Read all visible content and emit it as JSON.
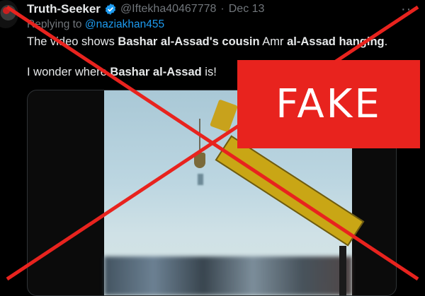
{
  "tweet": {
    "display_name": "Truth-Seeker",
    "handle": "@Iftekha40467778",
    "separator": "·",
    "time": "Dec 13",
    "more": "···",
    "replying_prefix": "Replying to ",
    "replying_to": "@naziakhan455",
    "line1": {
      "t1": "The video shows ",
      "b1": "Bashar al-Assad's cousin",
      "t2": " Amr ",
      "b2": "al-Assad hanging",
      "t3": "."
    },
    "line2": {
      "t1": "I wonder where ",
      "b1": "Bashar al-Assad",
      "t2": " is!"
    }
  },
  "stamp": {
    "label": "FAKE",
    "color": "#e8231e",
    "cross_color": "#e8231e"
  },
  "icons": {
    "verified": "verified-badge-icon",
    "more": "more-options-icon"
  },
  "colors": {
    "background": "#000000",
    "text": "#e7e9ea",
    "muted": "#71767b",
    "link": "#1d9bf0"
  }
}
